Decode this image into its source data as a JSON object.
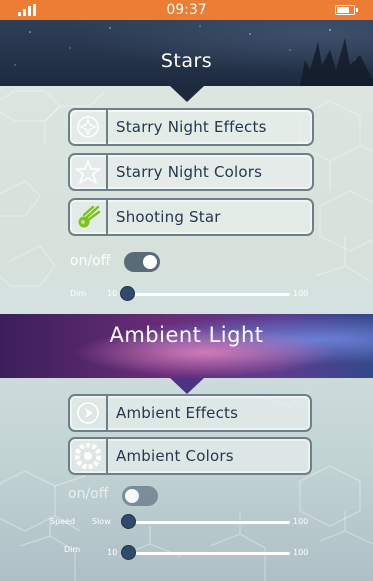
{
  "status_bar": {
    "time": "09:37",
    "background_color": "#ec7d32",
    "icons": [
      "signal-icon",
      "battery-icon"
    ]
  },
  "stars_section": {
    "title": "Stars",
    "buttons": [
      {
        "label": "Starry Night Effects",
        "icon": "compass-star-icon"
      },
      {
        "label": "Starry Night Colors",
        "icon": "star-outline-icon"
      },
      {
        "label": "Shooting Star",
        "icon": "shooting-star-icon",
        "icon_color": "#7bc21a"
      }
    ],
    "toggle": {
      "label": "on/off",
      "state": "on"
    },
    "dim_slider": {
      "label": "Dim",
      "min": "10",
      "max": "100",
      "value": 10
    }
  },
  "ambient_section": {
    "title": "Ambient Light",
    "buttons": [
      {
        "label": "Ambient Effects",
        "icon": "play-circle-icon"
      },
      {
        "label": "Ambient Colors",
        "icon": "color-wheel-icon"
      }
    ],
    "toggle": {
      "label": "on/off",
      "state": "on"
    },
    "speed_slider": {
      "label": "Speed",
      "min": "Slow",
      "max": "100",
      "value": 10
    },
    "dim_slider": {
      "label": "Dim",
      "min": "10",
      "max": "100",
      "value": 10
    }
  },
  "colors": {
    "accent": "#ec7d32",
    "button_border": "#6d8088",
    "button_text": "#26374f",
    "toggle_on": "#5a6b78",
    "slider_thumb": "#2f4a6a"
  }
}
